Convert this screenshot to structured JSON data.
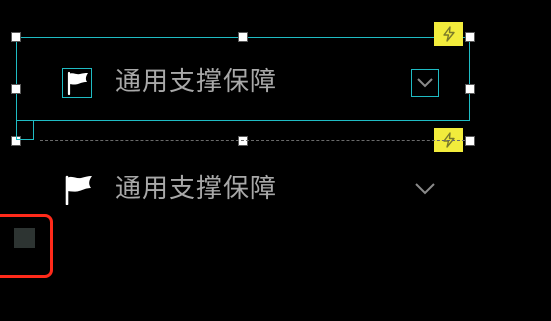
{
  "items": [
    {
      "label": "通用支撑保障",
      "icon": "flag-icon",
      "action_icon": "chevron-down-icon",
      "selected": true,
      "badge_icon": "lightning-icon"
    },
    {
      "label": "通用支撑保障",
      "icon": "flag-icon",
      "action_icon": "chevron-down-icon",
      "selected": false,
      "badge_icon": "lightning-icon"
    }
  ],
  "colors": {
    "background": "#000000",
    "selection": "#1fbcc4",
    "badge": "#f2ec3c",
    "label": "#a8a8a8",
    "highlight": "#ff2a1a",
    "swatch": "#2d3432"
  }
}
